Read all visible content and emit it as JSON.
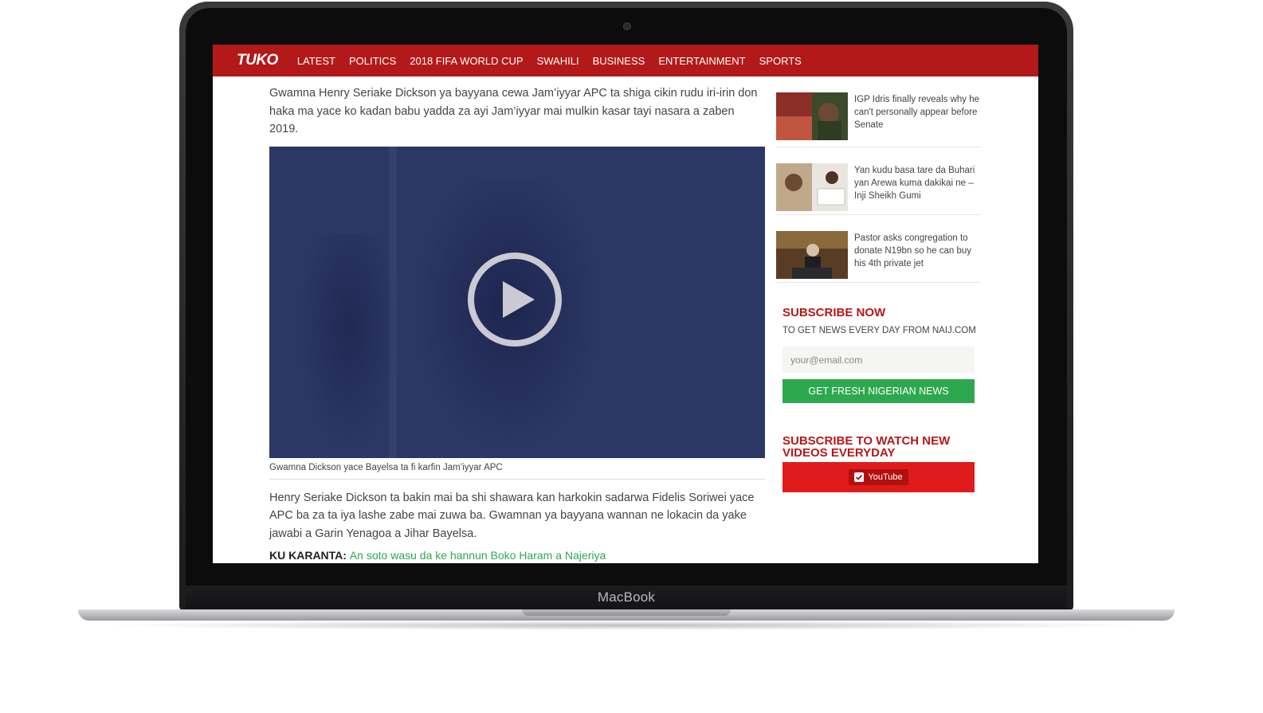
{
  "device": {
    "brand": "MacBook"
  },
  "nav": {
    "logo": "TUKO",
    "items": [
      "LATEST",
      "POLITICS",
      "2018 FIFA WORLD CUP",
      "SWAHILI",
      "BUSINESS",
      "ENTERTAINMENT",
      "SPORTS"
    ]
  },
  "article": {
    "intro": "Gwamna Henry Seriake Dickson ya bayyana cewa Jam’iyyar APC ta shiga cikin rudu iri-irin don haka ma yace ko kadan babu yadda za ayi Jam’iyyar mai mulkin kasar tayi nasara a zaben 2019.",
    "video_caption": "Gwamna Dickson yace Bayelsa ta fi karfin Jam’iyyar APC",
    "body": "Henry Seriake Dickson ta bakin mai ba shi shawara kan harkokin sadarwa Fidelis Soriwei yace APC ba za ta iya lashe zabe mai zuwa ba. Gwamnan ya bayyana wannan ne lokacin da yake jawabi a Garin Yenagoa a Jihar Bayelsa.",
    "read_more_label": "KU KARANTA:",
    "read_more_link": "An soto wasu da ke hannun Boko Haram a Najeriya"
  },
  "sidebar": {
    "news": [
      {
        "title": "IGP Idris finally reveals why he can't personally appear before Senate"
      },
      {
        "title": "Yan kudu basa tare da Buhari yan Arewa kuma dakikai ne – Inji Sheikh Gumi"
      },
      {
        "title": "Pastor asks congregation to donate N19bn so he can buy his 4th private jet"
      }
    ],
    "subscribe": {
      "title": "SUBSCRIBE NOW",
      "subtitle": "TO GET NEWS EVERY DAY FROM NAIJ.COM",
      "email_placeholder": "your@email.com",
      "button": "GET FRESH NIGERIAN NEWS"
    },
    "videos": {
      "title": "SUBSCRIBE TO WATCH NEW VIDEOS EVERYDAY",
      "button": "YouTube"
    }
  },
  "colors": {
    "brand_red": "#b41919",
    "video_bg": "#2c3766",
    "green": "#2ea84f",
    "youtube_red": "#e01b1b"
  }
}
